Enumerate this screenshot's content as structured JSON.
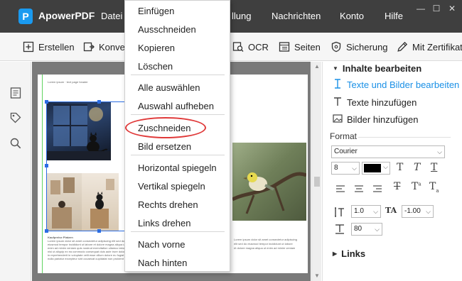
{
  "app": {
    "logo_letter": "P",
    "name": "ApowerPDF"
  },
  "menubar": {
    "items": [
      "Datei",
      "llung",
      "Nachrichten",
      "Konto",
      "Hilfe"
    ]
  },
  "window_controls": {
    "minimize": "—",
    "maximize": "☐",
    "close": "✕"
  },
  "toolbar": {
    "create": "Erstellen",
    "convert": "Konve",
    "ocr": "OCR",
    "pages": "Seiten",
    "security": "Sicherung",
    "certify": "Mit Zertifikat"
  },
  "context_menu": {
    "items": [
      "Einfügen",
      "Ausschneiden",
      "Kopieren",
      "Löschen",
      "Alle auswählen",
      "Auswahl aufheben",
      "Zuschneiden",
      "Bild ersetzen",
      "Horizontal spiegeln",
      "Vertikal spiegeln",
      "Rechts drehen",
      "Links drehen",
      "Nach vorne",
      "Nach hinten"
    ]
  },
  "right_panel": {
    "header": "Inhalte bearbeiten",
    "options": [
      "Texte und Bilder bearbeiten",
      "Texte hinzufügen",
      "Bilder hinzufügen"
    ],
    "format_label": "Format",
    "font": "Courier",
    "font_size": "8",
    "line_spacing": "1.0",
    "char_spacing": "-1.00",
    "scale": "80",
    "links_label": "Links",
    "text_color": "#000000",
    "accent_color": "#1a90e6"
  },
  "document": {
    "header_snippet": "Lorem ipsum · text page header",
    "caption_title": "Kaufpreise Platzen",
    "caption_lines": [
      "Lorem ipsum dolor sit amet consectetur adipiscing elit sed do",
      "eiusmod tempor incididunt ut labore et dolore magna aliqua ut",
      "enim ad minim veniam quis nostrud exercitation ullamco laboris",
      "nisi ut aliquip ex ea commodo consequat duis aute irure dolor",
      "in reprehenderit in voluptate velit esse cillum dolore eu fugiat",
      "nulla pariatur excepteur sint occaecat cupidatat non proident"
    ],
    "right_caption_lines": [
      "Lorem ipsum dolor sit amet consectetur adipiscing",
      "elit sed do eiusmod tempor incididunt ut labore",
      "et dolore magna aliqua ut enim ad minim veniam"
    ]
  }
}
